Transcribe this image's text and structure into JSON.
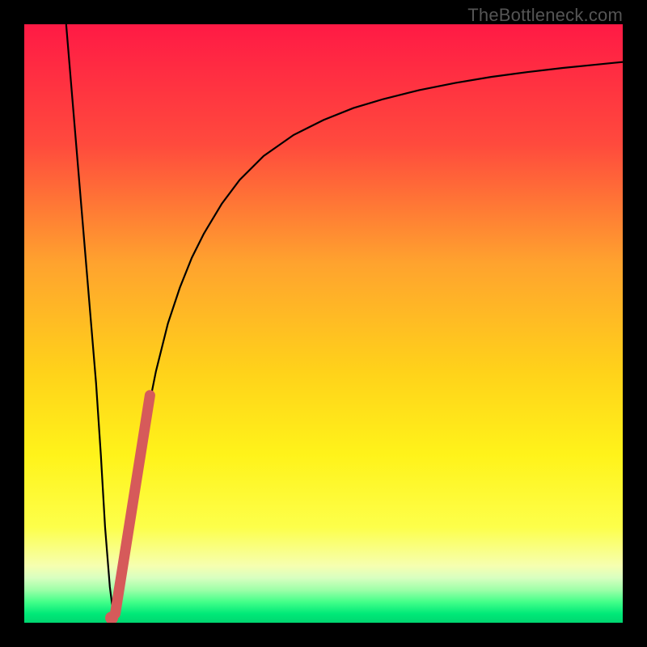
{
  "watermark": "TheBottleneck.com",
  "colors": {
    "frame": "#000000",
    "watermark_text": "#555555",
    "curve_stroke": "#000000",
    "marker_fill": "#d65a5a",
    "gradient_stops": [
      {
        "offset": 0.0,
        "color": "#ff1a45"
      },
      {
        "offset": 0.2,
        "color": "#ff4a3d"
      },
      {
        "offset": 0.4,
        "color": "#ffa32e"
      },
      {
        "offset": 0.58,
        "color": "#ffd21a"
      },
      {
        "offset": 0.72,
        "color": "#fff31a"
      },
      {
        "offset": 0.84,
        "color": "#fdff4a"
      },
      {
        "offset": 0.905,
        "color": "#f6ffb0"
      },
      {
        "offset": 0.925,
        "color": "#d8ffc0"
      },
      {
        "offset": 0.945,
        "color": "#9effa8"
      },
      {
        "offset": 0.965,
        "color": "#44ff8a"
      },
      {
        "offset": 0.985,
        "color": "#00e978"
      },
      {
        "offset": 1.0,
        "color": "#00d670"
      }
    ]
  },
  "chart_data": {
    "type": "line",
    "title": "",
    "xlabel": "",
    "ylabel": "",
    "xlim": [
      0,
      100
    ],
    "ylim": [
      0,
      100
    ],
    "grid": false,
    "series": [
      {
        "name": "bottleneck-curve",
        "x": [
          7,
          8,
          9,
          10,
          11,
          12,
          12.8,
          13.5,
          14.3,
          15,
          16,
          17,
          18,
          20,
          22,
          24,
          26,
          28,
          30,
          33,
          36,
          40,
          45,
          50,
          55,
          60,
          66,
          72,
          78,
          84,
          90,
          95,
          100
        ],
        "y": [
          100,
          88,
          76,
          64,
          52,
          40,
          28,
          16,
          6,
          0.5,
          4,
          12,
          20,
          32,
          42,
          50,
          56,
          61,
          65,
          70,
          74,
          78,
          81.5,
          84,
          86,
          87.5,
          89,
          90.2,
          91.2,
          92,
          92.7,
          93.2,
          93.7
        ]
      }
    ],
    "annotations": [
      {
        "name": "highlight-segment",
        "shape": "thick-line",
        "x0": 15.2,
        "y0": 1.5,
        "x1": 21.0,
        "y1": 38.0
      },
      {
        "name": "highlight-dot",
        "shape": "dot",
        "x": 14.6,
        "y": 0.8
      }
    ]
  }
}
